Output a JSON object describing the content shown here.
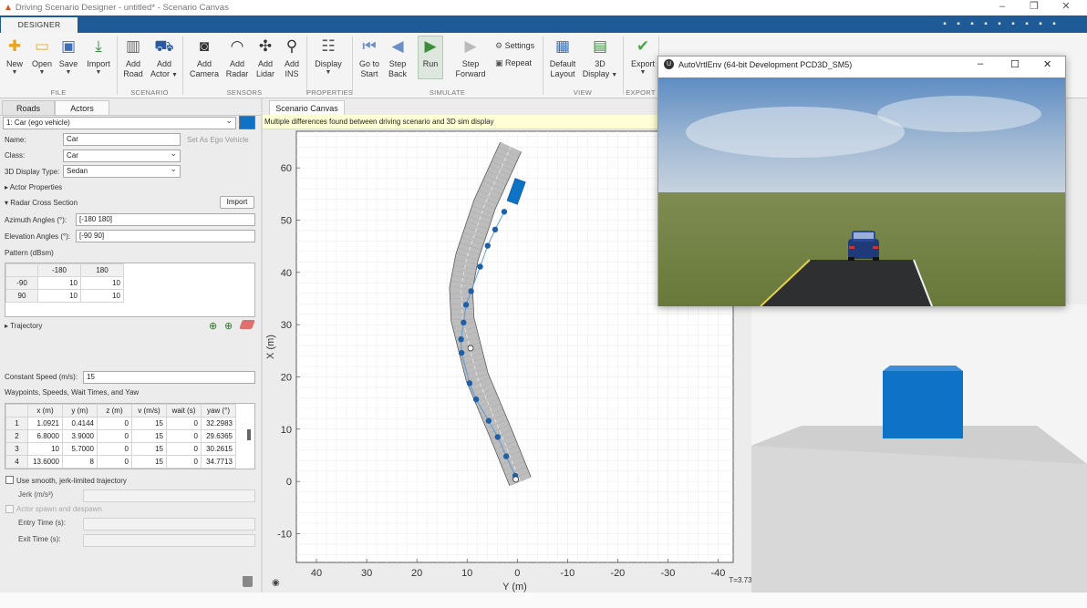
{
  "window": {
    "title": "Driving Scenario Designer - untitled* - Scenario Canvas",
    "minimize_glyph": "–",
    "restore_glyph": "❐",
    "close_glyph": "✕"
  },
  "tabs": {
    "designer": "DESIGNER"
  },
  "quick_access_icons": [
    "save-icon",
    "cut-icon",
    "copy-icon",
    "paste-icon",
    "undo-icon",
    "redo-icon",
    "help-icon",
    "expand-icon",
    "question-icon"
  ],
  "ribbon": {
    "buttons": [
      {
        "id": "new",
        "label": "New",
        "icon": "new-icon",
        "glyph": "✚",
        "color": "#e6a620",
        "dropdown": true
      },
      {
        "id": "open",
        "label": "Open",
        "icon": "folder-icon",
        "glyph": "▭",
        "color": "#e2b23a",
        "dropdown": true
      },
      {
        "id": "save",
        "label": "Save",
        "icon": "save-icon",
        "glyph": "▣",
        "color": "#3b6fb6",
        "dropdown": true
      },
      {
        "id": "import",
        "label": "Import",
        "icon": "import-icon",
        "glyph": "⤓",
        "color": "#3c8c3c",
        "dropdown": true
      },
      {
        "id": "add_road",
        "label": "Add\nRoad",
        "icon": "road-icon",
        "glyph": "▥",
        "color": "#666",
        "dropdown": false
      },
      {
        "id": "add_actor",
        "label": "Add\nActor",
        "icon": "car-icon",
        "glyph": "⛟",
        "color": "#2c5aa0",
        "dropdown": true
      },
      {
        "id": "add_camera",
        "label": "Add\nCamera",
        "icon": "camera-icon",
        "glyph": "◙",
        "color": "#333",
        "dropdown": false
      },
      {
        "id": "add_radar",
        "label": "Add\nRadar",
        "icon": "radar-icon",
        "glyph": "◠",
        "color": "#333",
        "dropdown": false
      },
      {
        "id": "add_lidar",
        "label": "Add\nLidar",
        "icon": "lidar-icon",
        "glyph": "✣",
        "color": "#333",
        "dropdown": false
      },
      {
        "id": "add_ins",
        "label": "Add\nINS",
        "icon": "ins-icon",
        "glyph": "⚲",
        "color": "#333",
        "dropdown": false
      },
      {
        "id": "display",
        "label": "Display",
        "icon": "display-icon",
        "glyph": "☷",
        "color": "#555",
        "dropdown": true
      },
      {
        "id": "go_to_start",
        "label": "Go to\nStart",
        "icon": "go-to-start-icon",
        "glyph": "⏮",
        "color": "#6a8fc8",
        "dropdown": false
      },
      {
        "id": "step_back",
        "label": "Step\nBack",
        "icon": "step-back-icon",
        "glyph": "◀",
        "color": "#6a8fc8",
        "dropdown": false
      },
      {
        "id": "run",
        "label": "Run",
        "icon": "run-icon",
        "glyph": "▶",
        "color": "#3c8c3c",
        "dropdown": false
      },
      {
        "id": "step_forward",
        "label": "Step\nForward",
        "icon": "step-forward-icon",
        "glyph": "▶",
        "color": "#bbb",
        "dropdown": false
      },
      {
        "id": "default_layout",
        "label": "Default\nLayout",
        "icon": "layout-icon",
        "glyph": "▦",
        "color": "#3b6fb6",
        "dropdown": false
      },
      {
        "id": "display_3d",
        "label": "3D\nDisplay",
        "icon": "3d-display-icon",
        "glyph": "▤",
        "color": "#3c8c3c",
        "dropdown": true
      },
      {
        "id": "export",
        "label": "Export",
        "icon": "export-check-icon",
        "glyph": "✔",
        "color": "#4aa84a",
        "dropdown": true
      }
    ],
    "settings_label": "Settings",
    "repeat_label": "Repeat",
    "groups": [
      "FILE",
      "SCENARIO",
      "SENSORS",
      "PROPERTIES",
      "SIMULATE",
      "VIEW",
      "EXPORT"
    ]
  },
  "left_panel": {
    "tabs": [
      "Roads",
      "Actors"
    ],
    "actor_select": "1: Car (ego vehicle)",
    "actor_color": "#0e72c6",
    "name_label": "Name:",
    "name_value": "Car",
    "set_ego_label": "Set As Ego Vehicle",
    "class_label": "Class:",
    "class_value": "Car",
    "display_type_label": "3D Display Type:",
    "display_type_value": "Sedan",
    "actor_properties_label": "Actor Properties",
    "radar_section_label": "Radar Cross Section",
    "radar_import_label": "Import",
    "azimuth_label": "Azimuth Angles (°):",
    "azimuth_value": "[-180 180]",
    "elevation_label": "Elevation Angles (°):",
    "elevation_value": "[-90 90]",
    "pattern_label": "Pattern (dBsm)",
    "pattern_table": {
      "col_headers": [
        "-180",
        "180"
      ],
      "rows": [
        {
          "h": "-90",
          "v": [
            "10",
            "10"
          ]
        },
        {
          "h": "90",
          "v": [
            "10",
            "10"
          ]
        }
      ]
    },
    "trajectory_label": "Trajectory",
    "constant_speed_label": "Constant Speed (m/s):",
    "constant_speed_value": "15",
    "waypoints_label": "Waypoints, Speeds, Wait Times, and Yaw",
    "waypoints_table": {
      "headers": [
        "x (m)",
        "y (m)",
        "z (m)",
        "v (m/s)",
        "wait (s)",
        "yaw (°)"
      ],
      "rows": [
        {
          "n": "1",
          "v": [
            "1.0921",
            "0.4144",
            "0",
            "15",
            "0",
            "32.2983"
          ]
        },
        {
          "n": "2",
          "v": [
            "6.8000",
            "3.9000",
            "0",
            "15",
            "0",
            "29.6365"
          ]
        },
        {
          "n": "3",
          "v": [
            "10",
            "5.7000",
            "0",
            "15",
            "0",
            "30.2615"
          ]
        },
        {
          "n": "4",
          "v": [
            "13.6000",
            "8",
            "0",
            "15",
            "0",
            "34.7713"
          ]
        }
      ]
    },
    "smooth_label": "Use smooth, jerk-limited trajectory",
    "jerk_label": "Jerk (m/s³)",
    "spawn_label": "Actor spawn and despawn",
    "entry_label": "Entry Time (s):",
    "exit_label": "Exit Time (s):"
  },
  "canvas": {
    "tab": "Scenario Canvas",
    "warning": "Multiple differences found between driving scenario and 3D sim display",
    "xlabel": "Y (m)",
    "ylabel": "X (m)",
    "xticks": [
      "40",
      "30",
      "20",
      "10",
      "0",
      "-10",
      "-20",
      "-30",
      "-40"
    ],
    "yticks": [
      "60",
      "50",
      "40",
      "30",
      "20",
      "10",
      "0",
      "-10"
    ],
    "time_label": "T=3.73s",
    "road_color": "#bdbdbd",
    "actor_color": "#0e72c6"
  },
  "chart_data": {
    "type": "scatter",
    "xlabel": "Y (m)",
    "ylabel": "X (m)",
    "xlim": [
      44,
      -43
    ],
    "ylim": [
      -15.5,
      67
    ],
    "road_centerline": [
      {
        "y": -0.6,
        "x": 0
      },
      {
        "y": 3.2,
        "x": 9
      },
      {
        "y": 8,
        "x": 20
      },
      {
        "y": 10.9,
        "x": 31
      },
      {
        "y": 11.2,
        "x": 37
      },
      {
        "y": 10,
        "x": 43
      },
      {
        "y": 6.5,
        "x": 53
      },
      {
        "y": 1.3,
        "x": 64
      }
    ],
    "waypoints": [
      {
        "y": 0.4,
        "x": 1.1
      },
      {
        "y": 2.2,
        "x": 4.8
      },
      {
        "y": 3.9,
        "x": 8.5
      },
      {
        "y": 5.7,
        "x": 11.6
      },
      {
        "y": 8.2,
        "x": 15.7
      },
      {
        "y": 9.5,
        "x": 18.8
      },
      {
        "y": 11.1,
        "x": 24.6
      },
      {
        "y": 11.2,
        "x": 27.2
      },
      {
        "y": 10.7,
        "x": 30.4
      },
      {
        "y": 10.2,
        "x": 33.8
      },
      {
        "y": 9.2,
        "x": 36.4
      },
      {
        "y": 7.4,
        "x": 41.1
      },
      {
        "y": 5.9,
        "x": 45.1
      },
      {
        "y": 4.4,
        "x": 48.2
      },
      {
        "y": 2.6,
        "x": 51.6
      }
    ],
    "origin_marker": {
      "y": 9.3,
      "x": 25.5
    },
    "start_marker": {
      "y": 0.3,
      "x": 0.4
    },
    "actor": {
      "y": 0.2,
      "x": 55.5
    }
  },
  "popup": {
    "title": "AutoVrtlEnv (64-bit Development PCD3D_SM5)",
    "minimize_glyph": "–",
    "maximize_glyph": "☐",
    "close_glyph": "✕"
  },
  "view3d": {
    "actor_color": "#0e72c6"
  }
}
